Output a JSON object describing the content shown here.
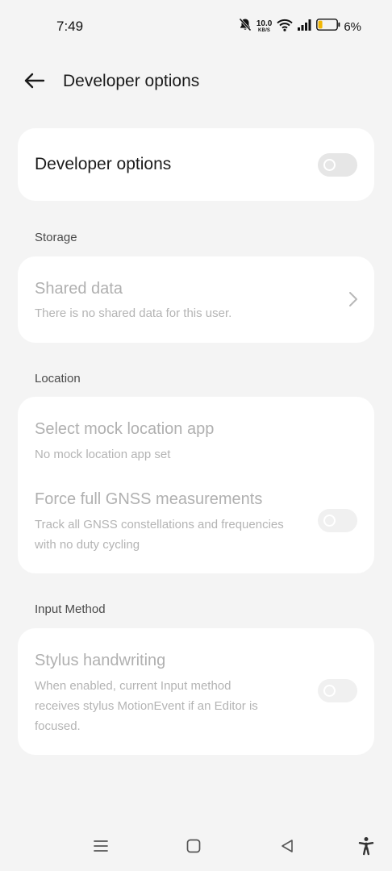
{
  "status_bar": {
    "time": "7:49",
    "net_speed_value": "10.0",
    "net_speed_unit": "KB/S",
    "battery_percent": "6%",
    "battery_color": "#f2b705"
  },
  "header": {
    "title": "Developer options"
  },
  "main_toggle": {
    "label": "Developer options",
    "enabled": false
  },
  "sections": {
    "storage": {
      "label": "Storage",
      "shared_data_title": "Shared data",
      "shared_data_sub": "There is no shared data for this user."
    },
    "location": {
      "label": "Location",
      "mock_title": "Select mock location app",
      "mock_sub": "No mock location app set",
      "gnss_title": "Force full GNSS measurements",
      "gnss_sub_line1": "Track all GNSS constellations and frequencies",
      "gnss_sub_line2": "with no duty cycling",
      "gnss_enabled": false
    },
    "input_method": {
      "label": "Input Method",
      "stylus_title": "Stylus handwriting",
      "stylus_sub_line1": "When enabled, current Input method",
      "stylus_sub_line2": "receives stylus MotionEvent if an Editor is",
      "stylus_sub_line3": "focused.",
      "stylus_enabled": false
    }
  },
  "nav_bar": {
    "icons": [
      "menu-icon",
      "home-icon",
      "back-triangle-icon",
      "accessibility-icon"
    ]
  }
}
